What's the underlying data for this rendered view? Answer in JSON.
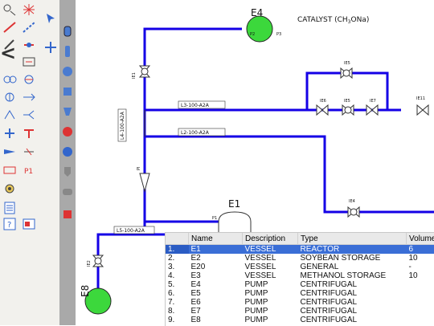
{
  "drawing": {
    "title_text": "CATALYST (CH3ONa)",
    "title_main": "CATALYST (CH",
    "title_sub": "3",
    "title_end": "ONa)",
    "equipment": {
      "e4": "E4",
      "e1": "E1",
      "e8": "E8"
    },
    "lines": {
      "l3": "L3-100-A2A",
      "l2": "L2-100-A2A",
      "l4": "L4-100-A2A",
      "l5": "L5-100-A2A"
    },
    "valves": {
      "ie1": "IE1",
      "ie5_top": "IE5",
      "ie6": "IE6",
      "ie5": "IE5",
      "ie7": "IE7",
      "ie11": "IE11",
      "ie4": "IE4",
      "ie2": "IE2",
      "pi": "PI"
    },
    "ports": {
      "p1": "P1",
      "p2": "P2",
      "p3": "P3"
    }
  },
  "grid": {
    "columns": [
      "Name",
      "Description",
      "Type",
      "Volume"
    ],
    "rows": [
      {
        "n": "1.",
        "name": "E1",
        "description": "VESSEL",
        "type": "REACTOR",
        "volume": "6"
      },
      {
        "n": "2.",
        "name": "E2",
        "description": "VESSEL",
        "type": "SOYBEAN STORAGE",
        "volume": "10"
      },
      {
        "n": "3.",
        "name": "E20",
        "description": "VESSEL",
        "type": "GENERAL",
        "volume": "-"
      },
      {
        "n": "4.",
        "name": "E3",
        "description": "VESSEL",
        "type": "METHANOL STORAGE",
        "volume": "10"
      },
      {
        "n": "5.",
        "name": "E4",
        "description": "PUMP",
        "type": "CENTRIFUGAL",
        "volume": ""
      },
      {
        "n": "6.",
        "name": "E5",
        "description": "PUMP",
        "type": "CENTRIFUGAL",
        "volume": ""
      },
      {
        "n": "7.",
        "name": "E6",
        "description": "PUMP",
        "type": "CENTRIFUGAL",
        "volume": ""
      },
      {
        "n": "8.",
        "name": "E7",
        "description": "PUMP",
        "type": "CENTRIFUGAL",
        "volume": ""
      },
      {
        "n": "9.",
        "name": "E8",
        "description": "PUMP",
        "type": "CENTRIFUGAL",
        "volume": ""
      }
    ],
    "selected_row": 0
  },
  "colors": {
    "pipe": "#1400e6",
    "pump_green": "#3cd83c",
    "selection": "#3a6ed6"
  },
  "collapse_glyph": "<"
}
